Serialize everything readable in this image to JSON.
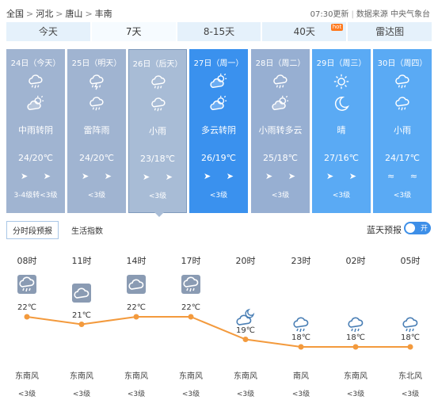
{
  "breadcrumb": [
    "全国",
    "河北",
    "唐山",
    "丰南"
  ],
  "meta": {
    "update": "07:30更新",
    "source": "数据来源 中央气象台"
  },
  "tabs": [
    {
      "label": "今天"
    },
    {
      "label": "7天",
      "active": true
    },
    {
      "label": "8-15天"
    },
    {
      "label": "40天",
      "badge": "hot"
    },
    {
      "label": "雷达图"
    }
  ],
  "days": [
    {
      "title": "24日（今天）",
      "icons": [
        "rain-cloud-icon",
        "cloud-sun-icon"
      ],
      "desc": "中雨转阴",
      "temp": "24/20℃",
      "wind_icons": "➤ ➤",
      "wind": "3-4级转<3级"
    },
    {
      "title": "25日（明天）",
      "icons": [
        "thunder-rain-icon",
        "rain-cloud-icon"
      ],
      "desc": "雷阵雨",
      "temp": "24/20℃",
      "wind_icons": "➤ ➤",
      "wind": "<3级"
    },
    {
      "title": "26日（后天）",
      "icons": [
        "rain-cloud-icon",
        "rain-cloud-icon"
      ],
      "desc": "小雨",
      "temp": "23/18℃",
      "wind_icons": "➤ ➤",
      "wind": "<3级"
    },
    {
      "title": "27日（周一）",
      "icons": [
        "cloud-sun-icon",
        "cloud-sun-icon"
      ],
      "desc": "多云转阴",
      "temp": "26/19℃",
      "wind_icons": "➤ ➤",
      "wind": "<3级"
    },
    {
      "title": "28日（周二）",
      "icons": [
        "rain-cloud-icon",
        "cloud-sun-icon"
      ],
      "desc": "小雨转多云",
      "temp": "25/18℃",
      "wind_icons": "➤ ➤",
      "wind": "<3级"
    },
    {
      "title": "29日（周三）",
      "icons": [
        "sun-icon",
        "moon-icon"
      ],
      "desc": "晴",
      "temp": "27/16℃",
      "wind_icons": "➤ ➤",
      "wind": "<3级"
    },
    {
      "title": "30日（周四）",
      "icons": [
        "rain-cloud-icon",
        "rain-cloud-icon"
      ],
      "desc": "小雨",
      "temp": "24/17℃",
      "wind_icons": "≈ ≈",
      "wind": "<3级"
    }
  ],
  "subtabs": [
    {
      "label": "分时段预报",
      "active": true
    },
    {
      "label": "生活指数"
    }
  ],
  "lantian": {
    "label": "蓝天预报",
    "toggle": "开"
  },
  "hourly": [
    {
      "time": "08时",
      "temp": "22℃",
      "temp_value": 22,
      "wind_dir": "东南风",
      "wind_level": "<3级",
      "icon": "rain-cloud-icon"
    },
    {
      "time": "11时",
      "temp": "21℃",
      "temp_value": 21,
      "wind_dir": "东南风",
      "wind_level": "<3级",
      "icon": "cloud-icon"
    },
    {
      "time": "14时",
      "temp": "22℃",
      "temp_value": 22,
      "wind_dir": "东南风",
      "wind_level": "<3级",
      "icon": "cloud-icon"
    },
    {
      "time": "17时",
      "temp": "22℃",
      "temp_value": 22,
      "wind_dir": "东南风",
      "wind_level": "<3级",
      "icon": "rain-cloud-icon"
    },
    {
      "time": "20时",
      "temp": "19℃",
      "temp_value": 19,
      "wind_dir": "东南风",
      "wind_level": "<3级",
      "icon": "cloud-moon-icon"
    },
    {
      "time": "23时",
      "temp": "18℃",
      "temp_value": 18,
      "wind_dir": "南风",
      "wind_level": "<3级",
      "icon": "rain-cloud-icon"
    },
    {
      "time": "02时",
      "temp": "18℃",
      "temp_value": 18,
      "wind_dir": "东南风",
      "wind_level": "<3级",
      "icon": "rain-cloud-icon"
    },
    {
      "time": "05时",
      "temp": "18℃",
      "temp_value": 18,
      "wind_dir": "东北风",
      "wind_level": "<3级",
      "icon": "rain-cloud-icon"
    }
  ],
  "colors": {
    "curve": "#f39a3d",
    "tab_bg": "#e5f1fb",
    "today_blue": "#3a91ee",
    "future_blue": "#5aaaf4"
  }
}
